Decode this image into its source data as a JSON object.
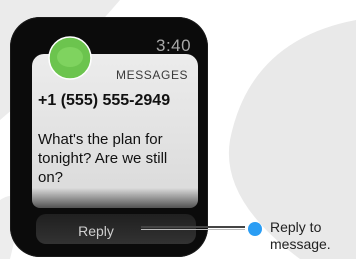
{
  "watch": {
    "time": "3:40",
    "notification": {
      "app_name": "MESSAGES",
      "sender": "+1 (555) 555-2949",
      "message": "What's the plan for tonight? Are we still on?",
      "reply_label": "Reply"
    }
  },
  "callout": {
    "text": "Reply to message."
  },
  "colors": {
    "app_icon_green": "#6cc44e",
    "callout_dot": "#2a9df4",
    "watch_body": "#0b0b0b",
    "card_background": "#e6e6e6"
  },
  "icons": {
    "app_icon": "messages-bubble-icon",
    "callout_marker": "callout-dot-icon"
  }
}
